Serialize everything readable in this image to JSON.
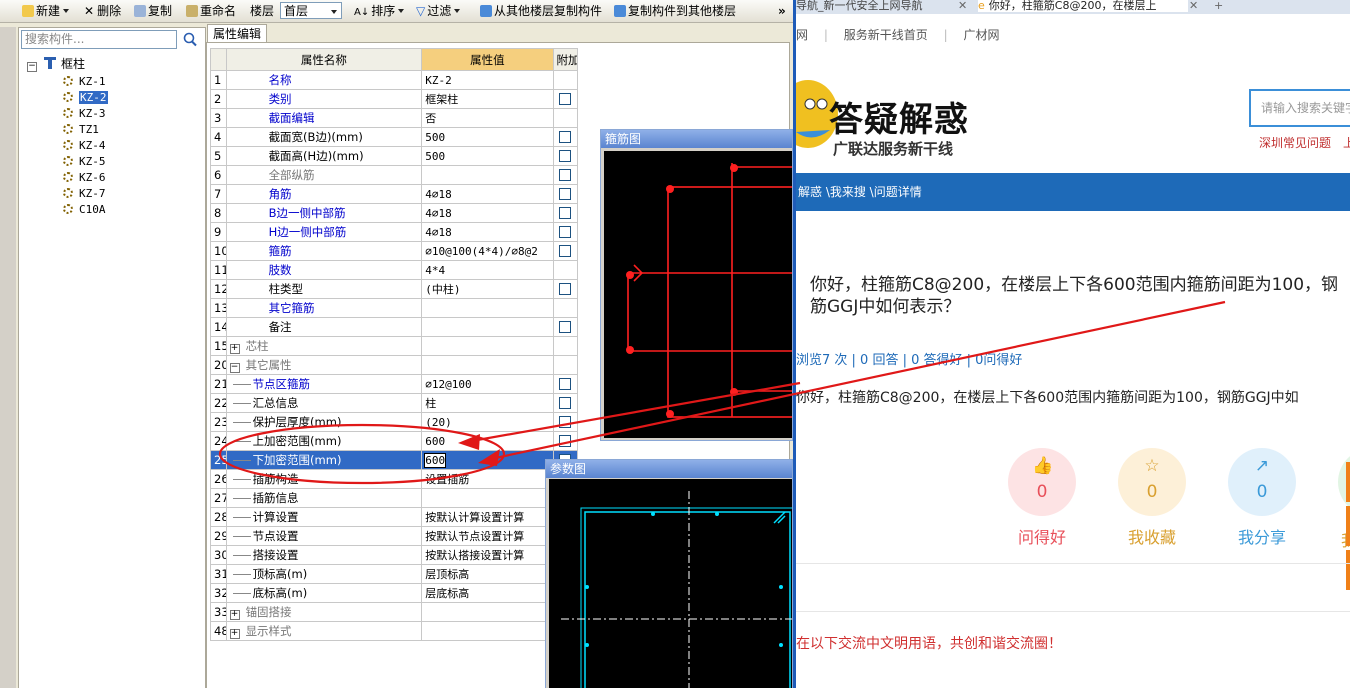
{
  "toolbar": {
    "new_label": "新建",
    "delete_label": "删除",
    "copy_label": "复制",
    "rename_label": "重命名",
    "floor_label": "楼层",
    "floor_value": "首层",
    "sort_label": "排序",
    "filter_label": "过滤",
    "copy_from_label": "从其他楼层复制构件",
    "copy_to_label": "复制构件到其他楼层",
    "more_label": "»"
  },
  "left_panel": {
    "search_placeholder": "搜索构件...",
    "tree_root": "框柱",
    "items": [
      "KZ-1",
      "KZ-2",
      "KZ-3",
      "TZ1",
      "KZ-4",
      "KZ-5",
      "KZ-6",
      "KZ-7",
      "C10A"
    ],
    "selected": "KZ-2"
  },
  "prop_panel": {
    "tab_label": "属性编辑",
    "headers": {
      "name": "属性名称",
      "value": "属性值",
      "extra": "附加"
    },
    "rows": [
      {
        "num": "1",
        "name": "名称",
        "value": "KZ-2"
      },
      {
        "num": "2",
        "name": "类别",
        "value": "框架柱"
      },
      {
        "num": "3",
        "name": "截面编辑",
        "value": "否"
      },
      {
        "num": "4",
        "name": "截面宽(B边)(mm)",
        "value": "500"
      },
      {
        "num": "5",
        "name": "截面高(H边)(mm)",
        "value": "500"
      },
      {
        "num": "6",
        "name": "全部纵筋",
        "value": ""
      },
      {
        "num": "7",
        "name": "角筋",
        "value": "4⌀18"
      },
      {
        "num": "8",
        "name": "B边一侧中部筋",
        "value": "4⌀18"
      },
      {
        "num": "9",
        "name": "H边一侧中部筋",
        "value": "4⌀18"
      },
      {
        "num": "10",
        "name": "箍筋",
        "value": "⌀10@100(4*4)/⌀8@2"
      },
      {
        "num": "11",
        "name": "肢数",
        "value": "4*4"
      },
      {
        "num": "12",
        "name": "柱类型",
        "value": "(中柱)"
      },
      {
        "num": "13",
        "name": "其它箍筋",
        "value": ""
      },
      {
        "num": "14",
        "name": "备注",
        "value": ""
      },
      {
        "num": "15",
        "name": "芯柱",
        "value": ""
      },
      {
        "num": "20",
        "name": "其它属性",
        "value": ""
      },
      {
        "num": "21",
        "name": "节点区箍筋",
        "value": "⌀12@100"
      },
      {
        "num": "22",
        "name": "汇总信息",
        "value": "柱"
      },
      {
        "num": "23",
        "name": "保护层厚度(mm)",
        "value": "(20)"
      },
      {
        "num": "24",
        "name": "上加密范围(mm)",
        "value": "600"
      },
      {
        "num": "25",
        "name": "下加密范围(mm)",
        "value": "600"
      },
      {
        "num": "26",
        "name": "插筋构造",
        "value": "设置插筋"
      },
      {
        "num": "27",
        "name": "插筋信息",
        "value": ""
      },
      {
        "num": "28",
        "name": "计算设置",
        "value": "按默认计算设置计算"
      },
      {
        "num": "29",
        "name": "节点设置",
        "value": "按默认节点设置计算"
      },
      {
        "num": "30",
        "name": "搭接设置",
        "value": "按默认搭接设置计算"
      },
      {
        "num": "31",
        "name": "顶标高(m)",
        "value": "层顶标高"
      },
      {
        "num": "32",
        "name": "底标高(m)",
        "value": "层底标高"
      },
      {
        "num": "33",
        "name": "锚固搭接",
        "value": ""
      },
      {
        "num": "48",
        "name": "显示样式",
        "value": ""
      }
    ]
  },
  "windows": {
    "stirrup_title": "箍筋图",
    "param_title": "参数图"
  },
  "browser": {
    "tab1": "导航_新一代安全上网导航",
    "tab2": "你好，柱箍筋C8@200，在楼层上",
    "nav_links": [
      "网",
      "服务新干线首页",
      "广材网"
    ],
    "header_title": "答疑解惑",
    "header_subtitle": "广联达服务新干线",
    "search_placeholder": "请输入搜索关键字",
    "hot_links": "深圳常见问题",
    "hot_links_2": "上",
    "breadcrumb": "解惑 \\我来搜 \\问题详情",
    "question_line1": "你好，柱箍筋C8@200，在楼层上下各600范围内箍筋间距为100，钢",
    "question_line2": "筋GGJ中如何表示？",
    "stats": "浏览7 次 | 0 回答 | 0 答得好 | 0问得好",
    "answer": "你好，柱箍筋C8@200，在楼层上下各600范围内箍筋间距为100，钢筋GGJ中如",
    "actions": [
      {
        "label": "问得好",
        "count": "0",
        "icon": "thumbs-up-icon",
        "color": "#e8505a",
        "bg": "#fde3e4"
      },
      {
        "label": "我收藏",
        "count": "0",
        "icon": "star-icon",
        "color": "#d9a030",
        "bg": "#fdf0d8"
      },
      {
        "label": "我分享",
        "count": "0",
        "icon": "share-icon",
        "color": "#3b9ad8",
        "bg": "#e0f0fb"
      }
    ],
    "action_partial": "我",
    "notice": "在以下交流中文明用语，共创和谐交流圈！"
  }
}
